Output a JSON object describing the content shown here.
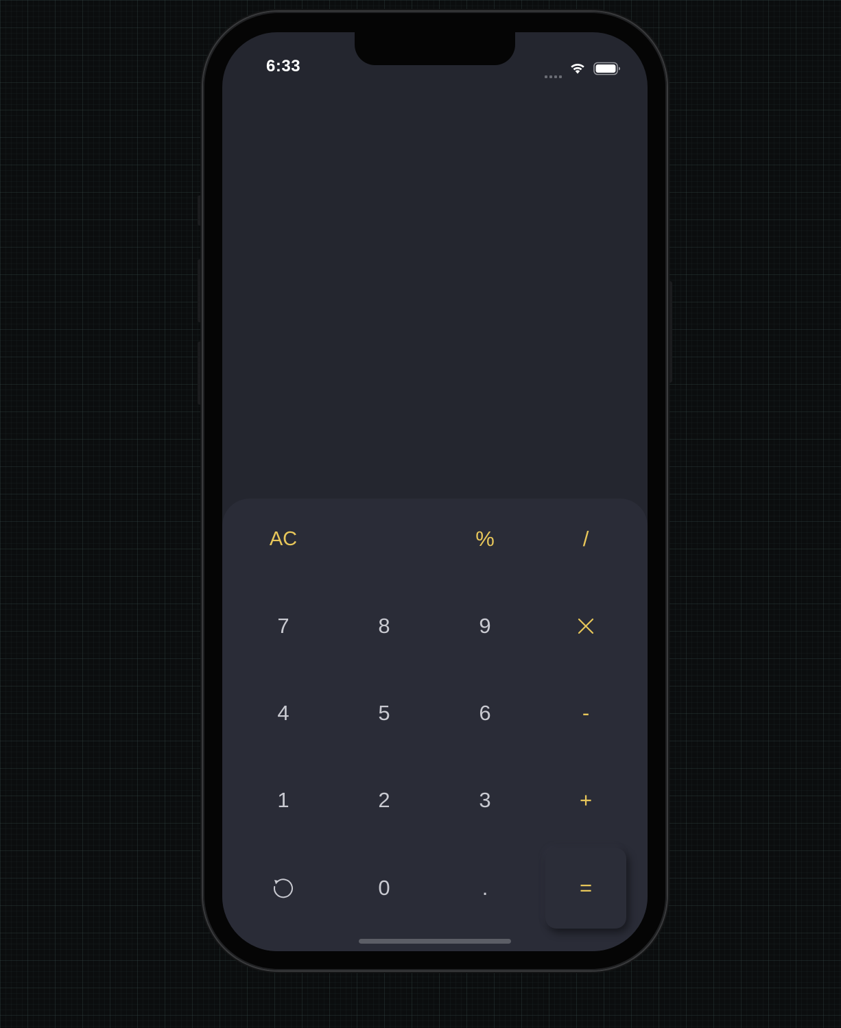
{
  "status_bar": {
    "time": "6:33",
    "signal_icon": "cellular-signal-icon",
    "wifi_icon": "wifi-icon",
    "battery_icon": "battery-full-icon"
  },
  "display": {
    "value": ""
  },
  "keypad": {
    "row1": {
      "clear": "AC",
      "percent": "%",
      "divide": "/"
    },
    "row2": {
      "seven": "7",
      "eight": "8",
      "nine": "9",
      "multiply": "×"
    },
    "row3": {
      "four": "4",
      "five": "5",
      "six": "6",
      "subtract": "-"
    },
    "row4": {
      "one": "1",
      "two": "2",
      "three": "3",
      "add": "+"
    },
    "row5": {
      "history_icon": "history-icon",
      "zero": "0",
      "decimal": ".",
      "equals": "="
    }
  },
  "colors": {
    "accent": "#e8c75a",
    "digit": "#c9cad1",
    "screen_background": "#24262f",
    "keypad_background": "#2a2c37"
  }
}
